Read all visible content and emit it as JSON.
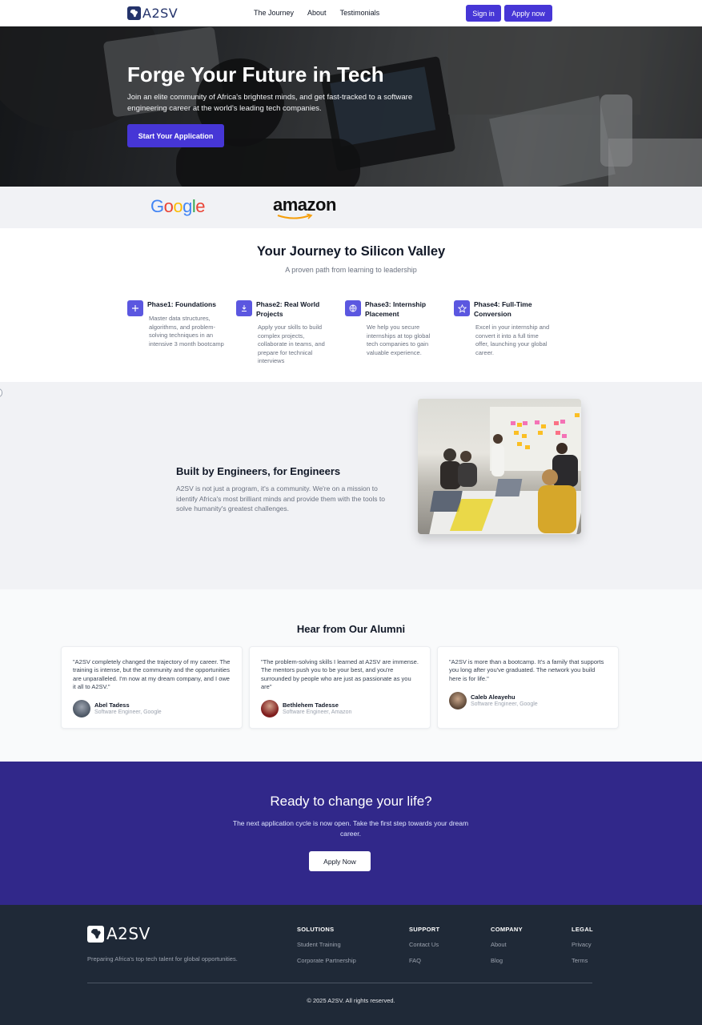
{
  "nav": {
    "brand": "A2SV",
    "links": [
      "The Journey",
      "About",
      "Testimonials"
    ],
    "signin_label": "Sign in",
    "apply_label": "Apply now"
  },
  "hero": {
    "title": "Forge Your Future in Tech",
    "subtitle": "Join an elite community of Africa's brightest minds, and get fast-tracked to a software engineering career at the world's leading tech companies.",
    "cta_label": "Start Your Application"
  },
  "partners": {
    "logos": [
      "Google",
      "amazon"
    ]
  },
  "journey": {
    "title": "Your Journey to Silicon Valley",
    "subtitle": "A proven path from learning to leadership",
    "phases": [
      {
        "icon": "plus-icon",
        "title": "Phase1: Foundations",
        "description": "Master data structures, algorithms, and problem-solving techniques in an intensive 3 month bootcamp"
      },
      {
        "icon": "download-icon",
        "title": "Phase2: Real World Projects",
        "description": "Apply your skills to build complex projects, collaborate in teams, and prepare for technical interviews"
      },
      {
        "icon": "globe-icon",
        "title": "Phase3: Internship Placement",
        "description": "We help you secure internships at top global tech companies to gain valuable experience."
      },
      {
        "icon": "star-icon",
        "title": "Phase4: Full-Time Conversion",
        "description": "Excel in your internship and convert it into a full time offer, launching your global career."
      }
    ]
  },
  "engineers": {
    "title": "Built by Engineers, for Engineers",
    "text": "A2SV is not just a program, it's a community. We're on a mission to identify Africa's most brilliant minds and provide them with the tools to solve humanity's greatest challenges."
  },
  "alumni": {
    "title": "Hear from Our Alumni",
    "testimonials": [
      {
        "quote": "\"A2SV completely changed the trajectory of my career. The training is intense, but the community and the opportunities are unparalleled. I'm now at my dream company, and I owe it all to A2SV.\"",
        "name": "Abel Tadess",
        "role": "Software Engineer, Google"
      },
      {
        "quote": "\"The problem-solving skills I learned at A2SV are immense. The mentors push you to be your best, and you're surrounded by people who are just as passionate as you are\"",
        "name": "Bethlehem Tadesse",
        "role": "Software Engineer, Amazon"
      },
      {
        "quote": "\"A2SV is more than a bootcamp. It's a family that supports you long after you've graduated. The network you build here is for life.\"",
        "name": "Caleb Aleayehu",
        "role": "Software Engineer, Google"
      }
    ]
  },
  "cta": {
    "title": "Ready to change your life?",
    "text": "The next application cycle is now open. Take the first step towards your dream career.",
    "button_label": "Apply Now"
  },
  "footer": {
    "brand": "A2SV",
    "tagline": "Preparing Africa's top tech talent for global opportunities.",
    "columns": [
      {
        "heading": "SOLUTIONS",
        "links": [
          "Student Training",
          "Corporate Partnership"
        ]
      },
      {
        "heading": "SUPPORT",
        "links": [
          "Contact Us",
          "FAQ"
        ]
      },
      {
        "heading": "COMPANY",
        "links": [
          "About",
          "Blog"
        ]
      },
      {
        "heading": "LEGAL",
        "links": [
          "Privacy",
          "Terms"
        ]
      }
    ],
    "copyright": "© 2025 A2SV. All rights reserved."
  },
  "colors": {
    "primary": "#4636d6",
    "cta_bg": "#31288a",
    "footer_bg": "#1f2937",
    "brand_navy": "#24336b"
  }
}
